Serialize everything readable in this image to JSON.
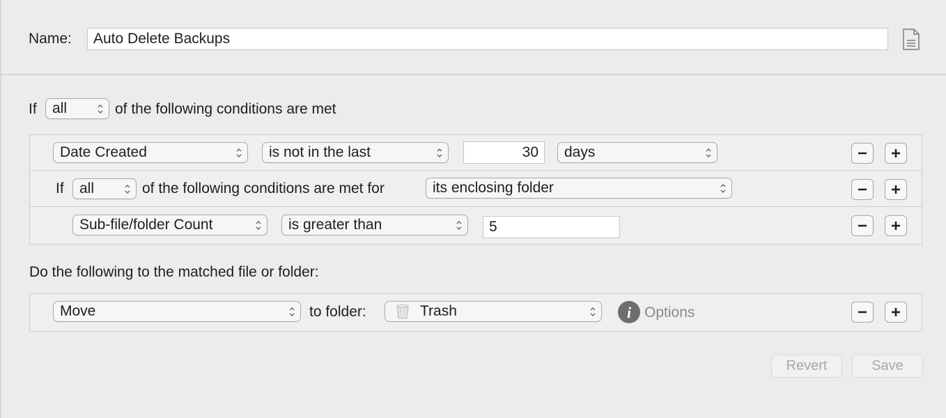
{
  "name_section": {
    "label": "Name:",
    "value": "Auto Delete Backups",
    "doc_icon": "document-icon"
  },
  "conditions": {
    "if_label": "If",
    "match_mode": "all",
    "suffix": "of the following conditions are met",
    "rows": [
      {
        "attribute": "Date Created",
        "operator": "is not in the last",
        "value": "30",
        "unit": "days"
      },
      {
        "if_label": "If",
        "match_mode": "all",
        "middle": "of the following conditions are met for",
        "target": "its enclosing folder"
      },
      {
        "attribute": "Sub-file/folder Count",
        "operator": "is greater than",
        "value": "5"
      }
    ]
  },
  "actions": {
    "heading": "Do the following to the matched file or folder:",
    "action": "Move",
    "to_folder_label": "to folder:",
    "folder": "Trash",
    "folder_icon": "trash-icon",
    "options_label": "Options",
    "options_icon": "info-icon"
  },
  "footer": {
    "revert_label": "Revert",
    "save_label": "Save"
  },
  "colors": {
    "background": "#ececec",
    "row_background": "#efefef",
    "disabled_text": "#a8a8a8"
  }
}
